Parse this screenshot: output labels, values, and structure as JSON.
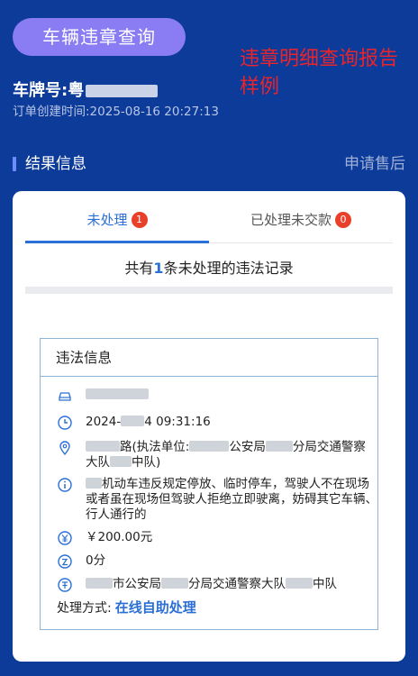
{
  "header": {
    "title": "车辆违章查询",
    "red_note": "违章明细查询报告样例",
    "plate_label": "车牌号:",
    "plate_value_visible": "粤",
    "order_time": "订单创建时间:2025-08-16 20:27:13"
  },
  "result": {
    "title": "结果信息",
    "after_sale": "申请售后"
  },
  "tabs": [
    {
      "label": "未处理",
      "count": "1"
    },
    {
      "label": "已处理未交款",
      "count": "0"
    }
  ],
  "summary": {
    "prefix": "共有",
    "count": "1",
    "suffix": "条未处理的违法记录"
  },
  "violation": {
    "title": "违法信息",
    "time_prefix": "2024-",
    "time_suffix": "4 09:31:16",
    "location_suffix": "路(执法单位:",
    "location_mid": "公安局",
    "location_tail": "分局交通警察大队",
    "location_end": "中队)",
    "behavior": "机动车违反规定停放、临时停车，驾驶人不在现场或者虽在现场但驾驶人拒绝立即驶离，妨碍其它车辆、行人通行的",
    "fine": "￥200.00元",
    "points": "0分",
    "agency_a": "市公安局",
    "agency_b": "分局交通警察大队",
    "agency_c": "中队",
    "method_label": "处理方式:",
    "method_link": "在线自助处理"
  },
  "colors": {
    "background": "#0d3b9a",
    "pill": "#8a7cf2",
    "accent": "#2a6fd6",
    "badge": "#e8402a",
    "note": "#e8242c"
  },
  "icons": [
    "car-icon",
    "clock-icon",
    "location-icon",
    "info-icon",
    "fine-icon",
    "points-icon",
    "agency-icon"
  ]
}
